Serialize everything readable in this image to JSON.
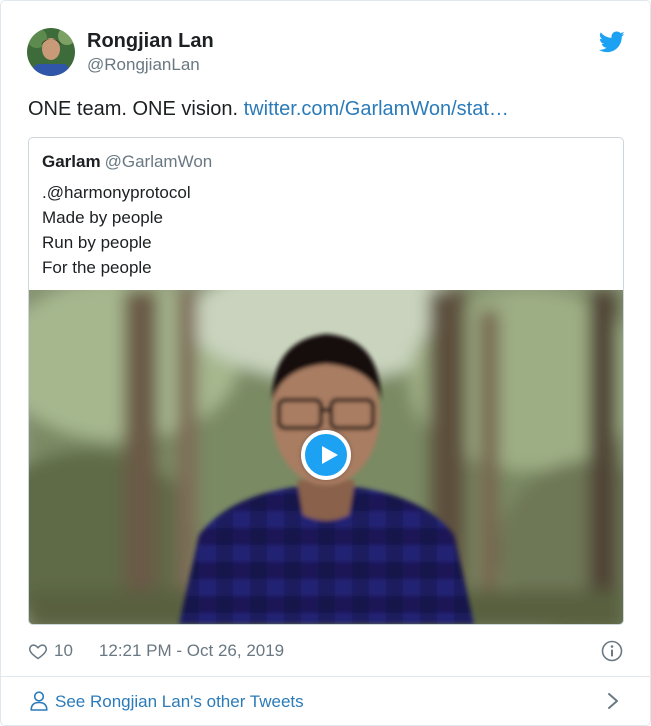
{
  "author": {
    "name": "Rongjian Lan",
    "handle": "@RongjianLan"
  },
  "tweet": {
    "text": "ONE team. ONE vision. ",
    "link": "twitter.com/GarlamWon/stat…"
  },
  "quoted": {
    "name": "Garlam",
    "handle": "@GarlamWon",
    "lines": [
      ".@harmonyprotocol",
      "Made by people",
      "Run by people",
      "For the people"
    ]
  },
  "meta": {
    "likes": "10",
    "timestamp": "12:21 PM - Oct 26, 2019"
  },
  "footer": {
    "label": "See Rongjian Lan's other Tweets"
  },
  "icons": {
    "brand": "twitter-bird-icon",
    "like": "heart-icon",
    "info": "info-icon",
    "profile": "person-icon",
    "more": "chevron-right-icon",
    "play": "play-icon"
  },
  "colors": {
    "brand_blue": "#1da1f2",
    "link_blue": "#2b7bb9",
    "muted": "#697882",
    "text": "#1c2022",
    "border": "#e1e8ed"
  }
}
